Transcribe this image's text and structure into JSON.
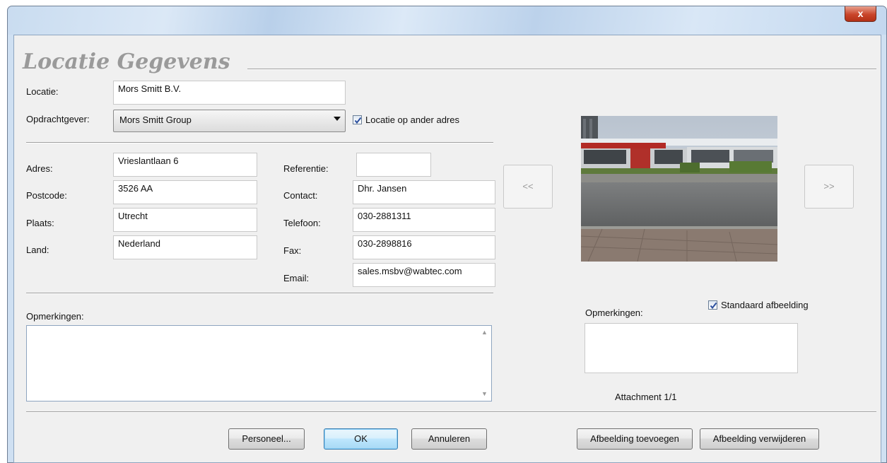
{
  "window": {
    "close_glyph": "x"
  },
  "header": {
    "title": "Locatie Gegevens"
  },
  "locatie": {
    "label": "Locatie:",
    "value": "Mors Smitt B.V."
  },
  "opdrachtgever": {
    "label": "Opdrachtgever:",
    "value": "Mors Smitt Group"
  },
  "locatie_ander_adres": {
    "label": "Locatie op ander adres",
    "checked": true
  },
  "address": {
    "adres_label": "Adres:",
    "adres_value": "Vrieslantlaan 6",
    "postcode_label": "Postcode:",
    "postcode_value": "3526 AA",
    "plaats_label": "Plaats:",
    "plaats_value": "Utrecht",
    "land_label": "Land:",
    "land_value": "Nederland"
  },
  "contact": {
    "referentie_label": "Referentie:",
    "referentie_value": "",
    "contact_label": "Contact:",
    "contact_value": "Dhr. Jansen",
    "telefoon_label": "Telefoon:",
    "telefoon_value": "030-2881311",
    "fax_label": "Fax:",
    "fax_value": "030-2898816",
    "email_label": "Email:",
    "email_value": "sales.msbv@wabtec.com"
  },
  "opmerkingen": {
    "label": "Opmerkingen:",
    "value": ""
  },
  "image_panel": {
    "prev_label": "<<",
    "next_label": ">>",
    "opmerkingen_label": "Opmerkingen:",
    "standaard_label": "Standaard afbeelding",
    "standaard_checked": true,
    "attachment_text": "Attachment 1/1"
  },
  "buttons": {
    "personeel": "Personeel...",
    "ok": "OK",
    "annuleren": "Annuleren",
    "afbeelding_toevoegen": "Afbeelding toevoegen",
    "afbeelding_verwijderen": "Afbeelding verwijderen"
  },
  "colors": {
    "title_gray": "#9a9a9a",
    "check_blue": "#2b4f9e",
    "ok_blue": "#3c7fb1"
  }
}
